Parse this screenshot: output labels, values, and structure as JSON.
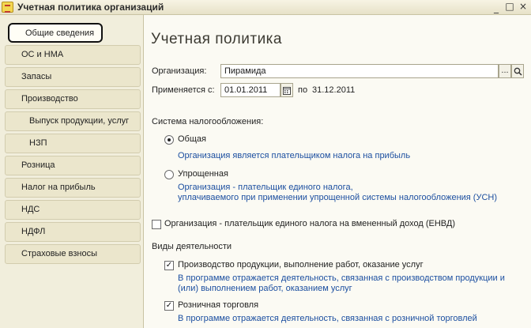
{
  "window": {
    "title": "Учетная политика организаций",
    "minimize": "_",
    "maximize": "□",
    "close": "×"
  },
  "sidebar": {
    "items": [
      {
        "label": "Общие сведения"
      },
      {
        "label": "ОС и НМА"
      },
      {
        "label": "Запасы"
      },
      {
        "label": "Производство"
      },
      {
        "label": "Выпуск продукции, услуг"
      },
      {
        "label": "НЗП"
      },
      {
        "label": "Розница"
      },
      {
        "label": "Налог на прибыль"
      },
      {
        "label": "НДС"
      },
      {
        "label": "НДФЛ"
      },
      {
        "label": "Страховые взносы"
      }
    ]
  },
  "main": {
    "title": "Учетная политика",
    "org_label": "Организация:",
    "org_value": "Пирамида",
    "org_more": "...",
    "applies_label": "Применяется с:",
    "applies_from": "01.01.2011",
    "applies_to_prefix": "по",
    "applies_to": "31.12.2011",
    "tax_system_label": "Система налогообложения:",
    "tax_general": "Общая",
    "tax_general_hint": "Организация является плательщиком налога на прибыль",
    "tax_simplified": "Упрощенная",
    "tax_simplified_hint1": "Организация - плательщик единого налога,",
    "tax_simplified_hint2": "уплачиваемого при применении упрощенной системы налогообложения (УСН)",
    "envd_label": "Организация - плательщик единого налога на вмененный доход (ЕНВД)",
    "activities_label": "Виды деятельности",
    "production_label": "Производство  продукции, выполнение работ, оказание услуг",
    "production_hint1": "В программе отражается деятельность, связанная с производством продукции и",
    "production_hint2": "(или) выполнением работ, оказанием услуг",
    "retail_label": "Розничная торговля",
    "retail_hint": "В программе отражается деятельность, связанная с розничной торговлей",
    "check_mark": "✓"
  },
  "colors": {
    "hint_text": "#1c4fa0",
    "sidebar_bg": "#f1eedc",
    "content_bg": "#fbfaf3"
  }
}
